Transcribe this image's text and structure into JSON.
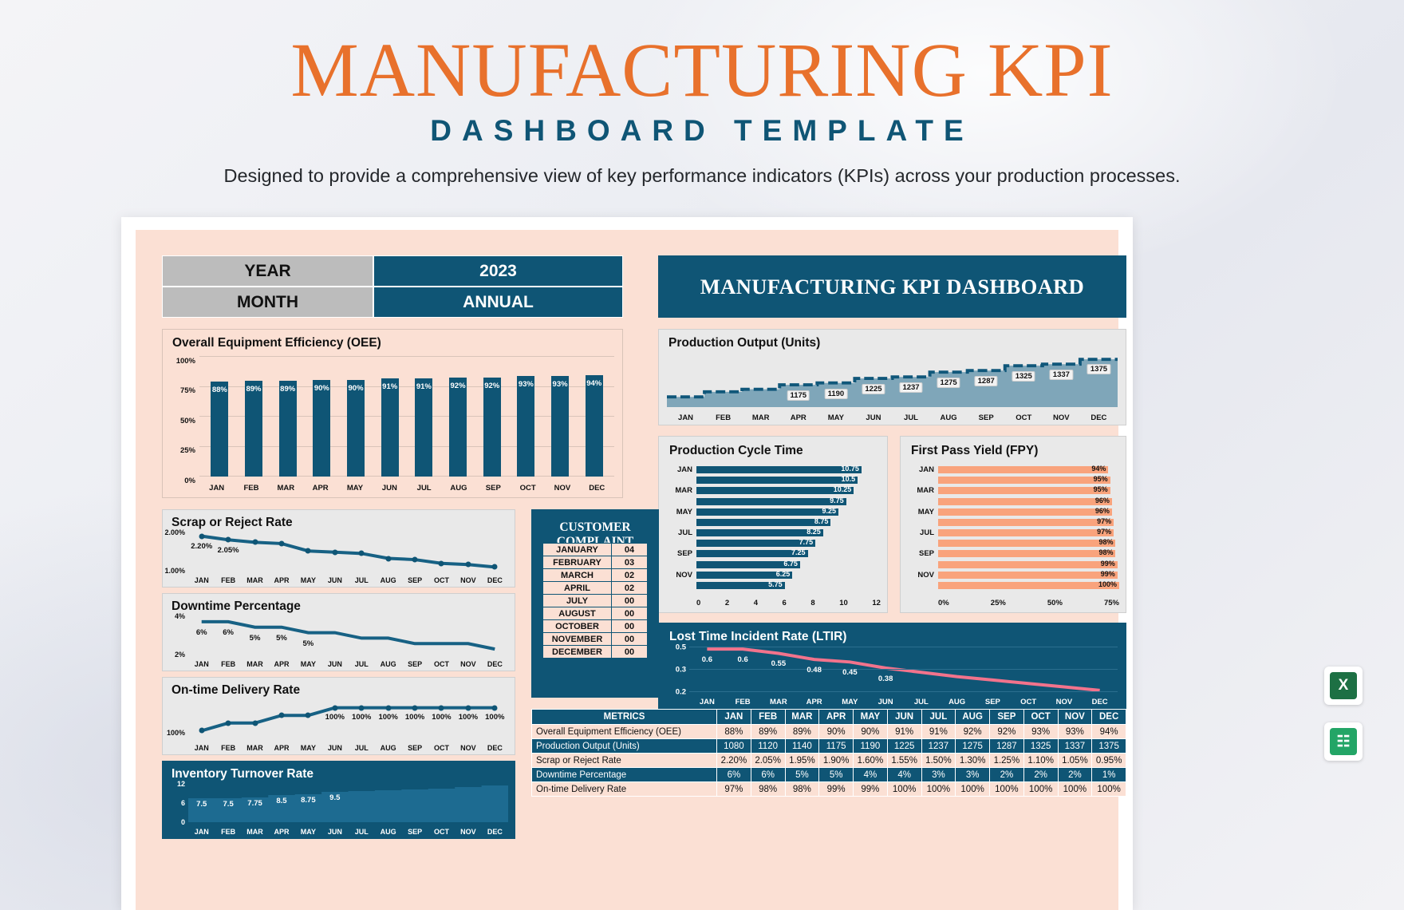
{
  "header": {
    "title_main": "MANUFACTURING KPI",
    "title_sub": "DASHBOARD TEMPLATE",
    "description": "Designed to provide a comprehensive view of key performance indicators (KPIs) across your production processes."
  },
  "filters": {
    "year_label": "YEAR",
    "year_value": "2023",
    "month_label": "MONTH",
    "month_value": "ANNUAL"
  },
  "banner": {
    "text": "MANUFACTURING KPI DASHBOARD"
  },
  "months": [
    "JAN",
    "FEB",
    "MAR",
    "APR",
    "MAY",
    "JUN",
    "JUL",
    "AUG",
    "SEP",
    "OCT",
    "NOV",
    "DEC"
  ],
  "customer_complaint": {
    "title": "CUSTOMER COMPLAINT",
    "rows": [
      {
        "month": "JANUARY",
        "value": "04"
      },
      {
        "month": "FEBRUARY",
        "value": "03"
      },
      {
        "month": "MARCH",
        "value": "02"
      },
      {
        "month": "APRIL",
        "value": "02"
      },
      {
        "month": "JULY",
        "value": "00"
      },
      {
        "month": "AUGUST",
        "value": "00"
      },
      {
        "month": "OCTOBER",
        "value": "00"
      },
      {
        "month": "NOVEMBER",
        "value": "00"
      },
      {
        "month": "DECEMBER",
        "value": "00"
      }
    ]
  },
  "metrics_table": {
    "header": [
      "METRICS",
      "JAN",
      "FEB",
      "MAR",
      "APR",
      "MAY",
      "JUN",
      "JUL",
      "AUG",
      "SEP",
      "OCT",
      "NOV",
      "DEC"
    ],
    "rows": [
      {
        "name": "Overall Equipment Efficiency (OEE)",
        "values": [
          "88%",
          "89%",
          "89%",
          "90%",
          "90%",
          "91%",
          "91%",
          "92%",
          "92%",
          "93%",
          "93%",
          "94%"
        ]
      },
      {
        "name": "Production Output (Units)",
        "values": [
          "1080",
          "1120",
          "1140",
          "1175",
          "1190",
          "1225",
          "1237",
          "1275",
          "1287",
          "1325",
          "1337",
          "1375"
        ]
      },
      {
        "name": "Scrap or Reject Rate",
        "values": [
          "2.20%",
          "2.05%",
          "1.95%",
          "1.90%",
          "1.60%",
          "1.55%",
          "1.50%",
          "1.30%",
          "1.25%",
          "1.10%",
          "1.05%",
          "0.95%"
        ]
      },
      {
        "name": "Downtime Percentage",
        "values": [
          "6%",
          "6%",
          "5%",
          "5%",
          "4%",
          "4%",
          "3%",
          "3%",
          "2%",
          "2%",
          "2%",
          "1%"
        ]
      },
      {
        "name": "On-time Delivery Rate",
        "values": [
          "97%",
          "98%",
          "98%",
          "99%",
          "99%",
          "100%",
          "100%",
          "100%",
          "100%",
          "100%",
          "100%",
          "100%"
        ]
      }
    ]
  },
  "icons": {
    "excel": {
      "glyph": "X",
      "color": "#1d7044"
    },
    "sheets": {
      "glyph": "☷",
      "color": "#23a566"
    }
  },
  "chart_data": [
    {
      "type": "bar",
      "title": "Overall Equipment Efficiency (OEE)",
      "categories": [
        "JAN",
        "FEB",
        "MAR",
        "APR",
        "MAY",
        "JUN",
        "JUL",
        "AUG",
        "SEP",
        "OCT",
        "NOV",
        "DEC"
      ],
      "values": [
        88,
        89,
        89,
        90,
        90,
        91,
        91,
        92,
        92,
        93,
        93,
        94
      ],
      "labels": [
        "88%",
        "89%",
        "89%",
        "90%",
        "90%",
        "91%",
        "91%",
        "92%",
        "92%",
        "93%",
        "93%",
        "94%"
      ],
      "yticks": [
        "0%",
        "25%",
        "50%",
        "75%",
        "100%"
      ],
      "ylim": [
        0,
        100
      ],
      "xlabel": "",
      "ylabel": "",
      "grid": true
    },
    {
      "type": "area",
      "title": "Production Output (Units)",
      "categories": [
        "JAN",
        "FEB",
        "MAR",
        "APR",
        "MAY",
        "JUN",
        "JUL",
        "AUG",
        "SEP",
        "OCT",
        "NOV",
        "DEC"
      ],
      "values": [
        1080,
        1120,
        1140,
        1175,
        1190,
        1225,
        1237,
        1275,
        1287,
        1325,
        1337,
        1375
      ],
      "labels": [
        "1080",
        "1120",
        "1140",
        "1175",
        "1190",
        "1225",
        "1237",
        "1275",
        "1287",
        "1325",
        "1337",
        "1375"
      ],
      "shown_labels": [
        "1175",
        "1190",
        "1225",
        "1237",
        "1275",
        "1287",
        "1325",
        "1337",
        "1375"
      ],
      "ylim": [
        1000,
        1420
      ],
      "grid": false
    },
    {
      "type": "bar",
      "orientation": "horizontal",
      "title": "Production Cycle Time",
      "categories": [
        "JAN",
        "FEB",
        "MAR",
        "APR",
        "MAY",
        "JUN",
        "JUL",
        "AUG",
        "SEP",
        "OCT",
        "NOV",
        "DEC"
      ],
      "tick_categories": [
        "JAN",
        "MAR",
        "MAY",
        "JUL",
        "SEP",
        "NOV"
      ],
      "values": [
        10.75,
        10.5,
        10.25,
        9.75,
        9.25,
        8.75,
        8.25,
        7.75,
        7.25,
        6.75,
        6.25,
        5.75
      ],
      "labels": [
        "10.75",
        "10.5",
        "10.25",
        "9.75",
        "9.25",
        "8.75",
        "8.25",
        "7.75",
        "7.25",
        "6.75",
        "6.25",
        "5.75"
      ],
      "xticks": [
        "0",
        "2",
        "4",
        "6",
        "8",
        "10",
        "12"
      ],
      "xlim": [
        0,
        12
      ]
    },
    {
      "type": "bar",
      "orientation": "horizontal",
      "title": "First Pass Yield (FPY)",
      "categories": [
        "JAN",
        "FEB",
        "MAR",
        "APR",
        "MAY",
        "JUN",
        "JUL",
        "AUG",
        "SEP",
        "OCT",
        "NOV",
        "DEC"
      ],
      "tick_categories": [
        "JAN",
        "MAR",
        "MAY",
        "JUL",
        "SEP",
        "NOV"
      ],
      "values": [
        94,
        95,
        95,
        96,
        96,
        97,
        97,
        98,
        98,
        99,
        99,
        100
      ],
      "labels": [
        "94%",
        "95%",
        "95%",
        "96%",
        "96%",
        "97%",
        "97%",
        "98%",
        "98%",
        "99%",
        "99%",
        "100%"
      ],
      "xticks": [
        "0%",
        "25%",
        "50%",
        "75%"
      ],
      "xlim": [
        0,
        100
      ]
    },
    {
      "type": "line",
      "title": "Lost Time Incident Rate (LTIR)",
      "categories": [
        "JAN",
        "FEB",
        "MAR",
        "APR",
        "MAY",
        "JUN",
        "JUL",
        "AUG",
        "SEP",
        "OCT",
        "NOV",
        "DEC"
      ],
      "values": [
        0.6,
        0.6,
        0.55,
        0.48,
        0.45,
        0.38,
        0.33,
        0.28,
        0.24,
        0.2,
        0.16,
        0.12
      ],
      "labels": [
        "0.6",
        "0.6",
        "0.55",
        "0.48",
        "0.45",
        "0.38"
      ],
      "yticks": [
        "0.2",
        "0.3",
        "0.5"
      ],
      "ylim": [
        0.1,
        0.62
      ],
      "line_color": "#f2738c"
    },
    {
      "type": "line",
      "title": "Scrap or Reject Rate",
      "categories": [
        "JAN",
        "FEB",
        "MAR",
        "APR",
        "MAY",
        "JUN",
        "JUL",
        "AUG",
        "SEP",
        "OCT",
        "NOV",
        "DEC"
      ],
      "values": [
        2.2,
        2.05,
        1.95,
        1.9,
        1.6,
        1.55,
        1.5,
        1.3,
        1.25,
        1.1,
        1.05,
        0.95
      ],
      "labels": [
        "2.20%",
        "2.05%"
      ],
      "yticks": [
        "1.00%",
        "2.00%"
      ],
      "ylim": [
        0.8,
        2.35
      ]
    },
    {
      "type": "line",
      "title": "Downtime Percentage",
      "categories": [
        "JAN",
        "FEB",
        "MAR",
        "APR",
        "MAY",
        "JUN",
        "JUL",
        "AUG",
        "SEP",
        "OCT",
        "NOV",
        "DEC"
      ],
      "values": [
        6,
        6,
        5,
        5,
        4,
        4,
        3,
        3,
        2,
        2,
        2,
        1
      ],
      "labels": [
        "6%",
        "6%",
        "5%",
        "5%",
        "5%"
      ],
      "yticks": [
        "2%",
        "4%"
      ],
      "ylim": [
        0,
        7
      ]
    },
    {
      "type": "line",
      "title": "On-time Delivery Rate",
      "categories": [
        "JAN",
        "FEB",
        "MAR",
        "APR",
        "MAY",
        "JUN",
        "JUL",
        "AUG",
        "SEP",
        "OCT",
        "NOV",
        "DEC"
      ],
      "values": [
        97,
        98,
        98,
        99,
        99,
        100,
        100,
        100,
        100,
        100,
        100,
        100
      ],
      "labels": [
        "100%",
        "100%",
        "100%",
        "100%",
        "100%",
        "100%",
        "100%"
      ],
      "yticks": [
        "100%"
      ],
      "ylim": [
        96,
        101
      ]
    },
    {
      "type": "area",
      "title": "Inventory Turnover Rate",
      "categories": [
        "JAN",
        "FEB",
        "MAR",
        "APR",
        "MAY",
        "JUN",
        "JUL",
        "AUG",
        "SEP",
        "OCT",
        "NOV",
        "DEC"
      ],
      "values": [
        7.5,
        7.5,
        7.75,
        8.5,
        8.75,
        9.5,
        9.75,
        10,
        10.25,
        10.5,
        11,
        11.5
      ],
      "labels": [
        "7.5",
        "7.5",
        "7.75",
        "8.5",
        "8.75",
        "9.5"
      ],
      "yticks": [
        "0",
        "6",
        "12"
      ],
      "ylim": [
        0,
        12
      ]
    }
  ]
}
